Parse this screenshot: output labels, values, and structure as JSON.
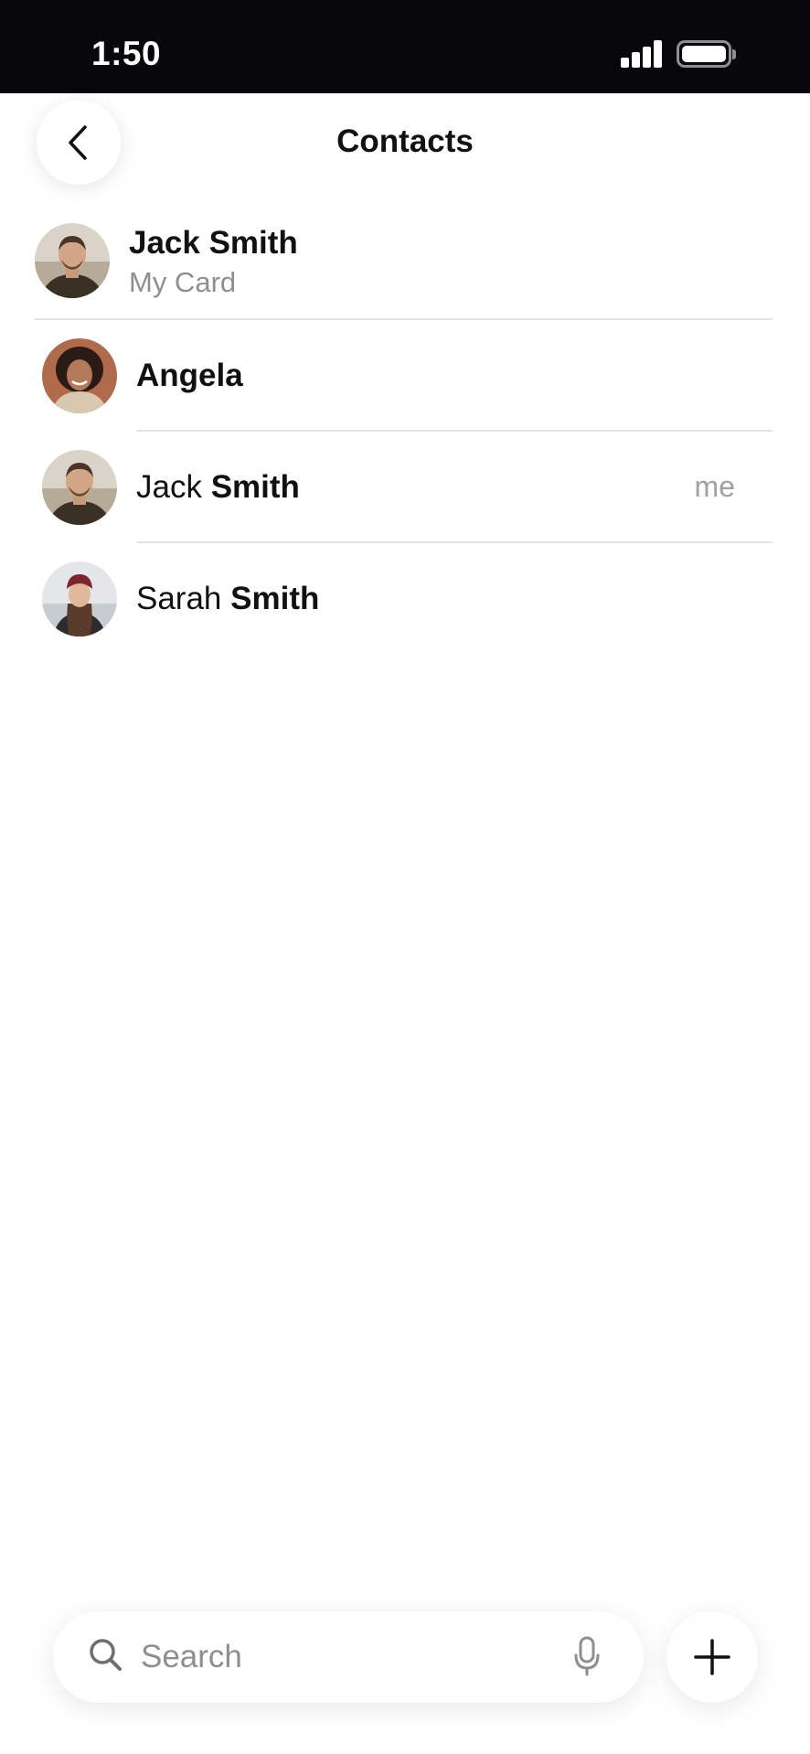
{
  "status_bar": {
    "time": "1:50",
    "icons": [
      "cellular-signal-icon",
      "battery-icon"
    ]
  },
  "header": {
    "title": "Contacts",
    "back_icon": "chevron-left-icon"
  },
  "my_card": {
    "name": "Jack Smith",
    "subtitle": "My Card"
  },
  "contacts": [
    {
      "first": "Angela",
      "last": "",
      "badge": ""
    },
    {
      "first": "Jack ",
      "last": "Smith",
      "badge": "me"
    },
    {
      "first": "Sarah ",
      "last": "Smith",
      "badge": ""
    }
  ],
  "search": {
    "placeholder": "Search",
    "icons": [
      "search-icon",
      "microphone-icon"
    ]
  },
  "add_button_icon": "plus-icon",
  "colors": {
    "status_bar_bg": "#07070c",
    "secondary_text": "#8e8e93",
    "divider": "#e4e4e8"
  }
}
